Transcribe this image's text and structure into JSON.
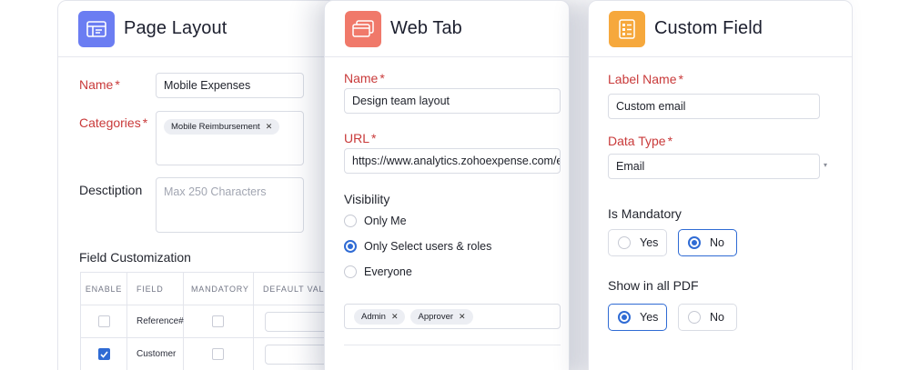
{
  "page_layout": {
    "title": "Page Layout",
    "name_label": "Name",
    "name_value": "Mobile Expenses",
    "categories_label": "Categories",
    "category_chip": "Mobile Reimbursement",
    "description_label": "Desctiption",
    "description_placeholder": "Max 250 Characters",
    "field_customization_label": "Field Customization",
    "table": {
      "headers": [
        "ENABLE",
        "FIELD",
        "MANDATORY",
        "DEFAULT VAL"
      ],
      "rows": [
        {
          "field": "Reference#",
          "enabled": false
        },
        {
          "field": "Customer",
          "enabled": true
        }
      ]
    }
  },
  "web_tab": {
    "title": "Web Tab",
    "name_label": "Name",
    "name_value": "Design team layout",
    "url_label": "URL",
    "url_value": "https://www.analytics.zohoexpense.com/e..",
    "visibility_label": "Visibility",
    "visibility_options": [
      "Only Me",
      "Only Select users & roles",
      "Everyone"
    ],
    "visibility_selected": 1,
    "role_chips": [
      "Admin",
      "Approver"
    ]
  },
  "custom_field": {
    "title": "Custom Field",
    "label_name_label": "Label Name",
    "label_name_value": "Custom email",
    "data_type_label": "Data Type",
    "data_type_value": "Email",
    "is_mandatory_label": "Is Mandatory",
    "mandatory_yes": "Yes",
    "mandatory_no": "No",
    "mandatory_selected": "No",
    "show_pdf_label": "Show in all PDF",
    "pdf_yes": "Yes",
    "pdf_no": "No",
    "pdf_selected": "Yes"
  },
  "colors": {
    "page_layout_icon": "#6b7df2",
    "web_tab_icon": "#f0796a",
    "custom_field_icon": "#f6a83c",
    "required_label": "#c93a3a",
    "accent": "#2f6bd4"
  },
  "icons": {
    "page_layout": "layout-icon",
    "web_tab": "browser-tabs-icon",
    "custom_field": "form-fields-icon"
  }
}
